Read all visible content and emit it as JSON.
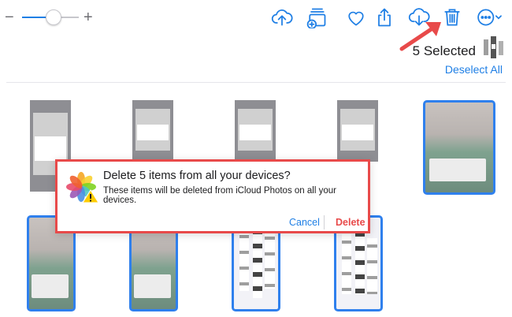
{
  "toolbar": {
    "zoom_minus": "−",
    "zoom_plus": "+",
    "zoom_level": 0.55,
    "icons": [
      "upload-cloud-icon",
      "add-to-album-icon",
      "heart-icon",
      "share-icon",
      "download-cloud-icon",
      "trash-icon",
      "more-icon"
    ]
  },
  "selection": {
    "count_label": "5 Selected",
    "deselect_label": "Deselect All"
  },
  "dialog": {
    "title": "Delete 5 items from all your devices?",
    "message": "These items will be deleted from iCloud Photos on all your devices.",
    "cancel_label": "Cancel",
    "delete_label": "Delete"
  },
  "colors": {
    "accent": "#1f7fe5",
    "destructive": "#e84a4a",
    "selection_border": "#2f80ed"
  }
}
